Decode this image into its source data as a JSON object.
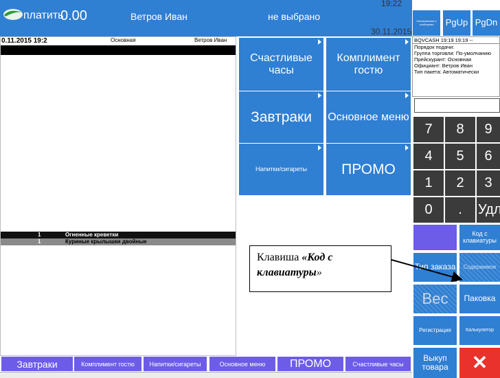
{
  "header": {
    "pay_label": "платить",
    "amount": "0.00",
    "waiter": "Ветров Иван",
    "table": "не выбрано",
    "time": "19:22",
    "date": "30.11.2015"
  },
  "order": {
    "head_date": "0.11.2015 19:2",
    "head_type": "Основная",
    "head_waiter": "Ветров Иван",
    "items": [
      {
        "qty": "1",
        "name": "Огненные креветки"
      },
      {
        "qty": "1",
        "name": "Куриные крылышки двойные"
      }
    ]
  },
  "categories": [
    {
      "label": "Счастливые часы"
    },
    {
      "label": "Комплимент гостю"
    },
    {
      "label": "Завтраки"
    },
    {
      "label": "Основное меню"
    },
    {
      "label": "Напитки/сигареты"
    },
    {
      "label": "ПРОМО"
    }
  ],
  "top_right": {
    "small_btn": "Напоминания и сообщения",
    "pgup": "PgUp",
    "pgdn": "PgDn"
  },
  "info": {
    "line1": "BQVCASH    19:19   19:19   --",
    "line2": "Порядок подачи:",
    "line3": "Группа торговли: По-умолчанию",
    "line4": "Прейскурант: Основная",
    "line5": "Официант: Ветров Иван",
    "line6": "Тип пакета: Автоматически"
  },
  "keypad": [
    "7",
    "8",
    "9",
    "4",
    "5",
    "6",
    "1",
    "2",
    "3",
    "0",
    ".",
    "Удл"
  ],
  "buttons": {
    "code_kb": "Код с клавиатуры",
    "order_type": "Тип заказа",
    "contents": "Содержимое",
    "weight": "Вес",
    "packing": "Паковка",
    "registration": "Регистрация",
    "calculator": "Калькулятор",
    "buyback": "Выкуп товара",
    "delete": "✕"
  },
  "tabs": [
    "Завтраки",
    "Комплимент гостю",
    "Напитки/сигареты",
    "Основное меню",
    "ПРОМО",
    "Счастливые часы"
  ],
  "callout": {
    "prefix": "Клавиша ",
    "key_name": "«Код с клавиатуры",
    "suffix": "»"
  }
}
